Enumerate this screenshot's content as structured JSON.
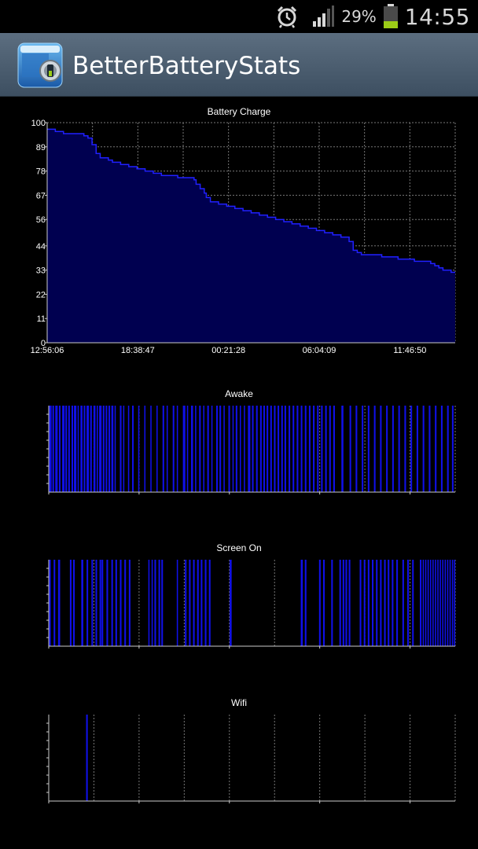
{
  "status_bar": {
    "battery_percent": "29%",
    "time": "14:55",
    "icons": [
      "alarm-clock-icon",
      "signal-strength-icon",
      "battery-icon"
    ]
  },
  "app": {
    "title": "BetterBatteryStats",
    "icon": "better-battery-stats-app-icon"
  },
  "colors": {
    "series_fill": "#000050",
    "series_line": "#2020ff",
    "bar_color": "#1010e8",
    "grid": "#777777",
    "background": "#000000",
    "action_bar": "#4a5c6e"
  },
  "chart_data": [
    {
      "type": "area",
      "title": "Battery Charge",
      "x_ticks": [
        "12:56:06",
        "18:38:47",
        "00:21:28",
        "06:04:09",
        "11:46:50"
      ],
      "y_ticks": [
        "0",
        "11",
        "22",
        "33",
        "44",
        "56",
        "67",
        "78",
        "89",
        "100"
      ],
      "ylim": [
        0,
        100
      ],
      "xlim": [
        0,
        100
      ],
      "grid": true,
      "x": [
        0,
        0.5,
        2,
        3,
        4,
        6,
        8,
        9,
        10,
        11,
        12,
        13,
        15,
        16,
        18,
        20,
        22,
        24,
        26,
        28,
        30,
        32,
        34,
        36,
        36.5,
        37.5,
        38.5,
        39,
        40,
        42,
        44,
        46,
        48,
        50,
        52,
        54,
        56,
        58,
        60,
        62,
        64,
        66,
        68,
        70,
        72,
        74,
        75,
        76,
        77,
        78,
        79,
        80,
        82,
        84,
        86,
        88,
        90,
        92,
        94,
        95,
        96,
        97,
        98,
        99,
        100
      ],
      "values": [
        97,
        97,
        96,
        96,
        95,
        95,
        95,
        94,
        93,
        90,
        86,
        84,
        83,
        82,
        81,
        80,
        79,
        78,
        77,
        76,
        76,
        75,
        75,
        74,
        72,
        70,
        68,
        66,
        64,
        63,
        62,
        61,
        60,
        59,
        58,
        57,
        56,
        55,
        54,
        53,
        52,
        51,
        50,
        49,
        48,
        46,
        42,
        41,
        40,
        40,
        40,
        40,
        39,
        39,
        38,
        38,
        37,
        37,
        36,
        35,
        34,
        33,
        33,
        32,
        32
      ]
    },
    {
      "type": "bar",
      "title": "Awake",
      "ylim": [
        0,
        1
      ],
      "grid": true,
      "segments": [
        [
          0,
          0.7
        ],
        [
          0.9,
          1.3
        ],
        [
          1.6,
          2.2
        ],
        [
          2.5,
          2.9
        ],
        [
          3.3,
          3.9
        ],
        [
          4.1,
          4.5
        ],
        [
          4.8,
          5.2
        ],
        [
          5.6,
          6.0
        ],
        [
          6.2,
          6.8
        ],
        [
          7.1,
          7.4
        ],
        [
          7.8,
          8.3
        ],
        [
          8.6,
          9.0
        ],
        [
          9.3,
          9.9
        ],
        [
          10.2,
          10.6
        ],
        [
          11.0,
          11.5
        ],
        [
          11.8,
          12.1
        ],
        [
          12.4,
          13.0
        ],
        [
          13.3,
          13.7
        ],
        [
          14.0,
          14.4
        ],
        [
          14.7,
          15.1
        ],
        [
          15.4,
          15.9
        ],
        [
          16.2,
          16.4
        ],
        [
          17.5,
          17.9
        ],
        [
          18.3,
          18.6
        ],
        [
          19.5,
          19.8
        ],
        [
          20.5,
          20.9
        ],
        [
          22.0,
          22.3
        ],
        [
          23.5,
          23.8
        ],
        [
          25.0,
          25.3
        ],
        [
          26.5,
          26.8
        ],
        [
          28.0,
          28.4
        ],
        [
          29.0,
          29.3
        ],
        [
          30.5,
          30.9
        ],
        [
          31.5,
          31.8
        ],
        [
          33.0,
          33.6
        ],
        [
          34.0,
          34.3
        ],
        [
          35.0,
          35.5
        ],
        [
          36.0,
          36.3
        ],
        [
          37.0,
          37.4
        ],
        [
          38.0,
          38.3
        ],
        [
          39.0,
          39.4
        ],
        [
          40.0,
          40.3
        ],
        [
          41.2,
          41.6
        ],
        [
          42.0,
          42.4
        ],
        [
          43.0,
          43.3
        ],
        [
          44.2,
          44.6
        ],
        [
          45.2,
          45.5
        ],
        [
          46.0,
          46.4
        ],
        [
          47.0,
          47.3
        ],
        [
          48.0,
          48.3
        ],
        [
          49.0,
          49.6
        ],
        [
          50.0,
          50.4
        ],
        [
          51.0,
          51.4
        ],
        [
          52.0,
          52.4
        ],
        [
          52.8,
          53.2
        ],
        [
          53.6,
          54.0
        ],
        [
          54.5,
          54.9
        ],
        [
          55.4,
          55.8
        ],
        [
          56.3,
          56.7
        ],
        [
          57.2,
          57.6
        ],
        [
          58.0,
          58.4
        ],
        [
          59.0,
          59.4
        ],
        [
          60.0,
          60.4
        ],
        [
          61.0,
          61.4
        ],
        [
          62.0,
          62.4
        ],
        [
          63.0,
          63.4
        ],
        [
          64.0,
          64.4
        ],
        [
          65.0,
          65.4
        ],
        [
          66.0,
          66.4
        ],
        [
          67.0,
          67.4
        ],
        [
          68.0,
          68.4
        ],
        [
          69.0,
          69.4
        ],
        [
          70.0,
          70.4
        ],
        [
          72.0,
          72.5
        ],
        [
          74.0,
          74.4
        ],
        [
          75.5,
          75.9
        ],
        [
          77.0,
          77.4
        ],
        [
          78.5,
          78.9
        ],
        [
          80.0,
          80.4
        ],
        [
          81.5,
          81.9
        ],
        [
          83.0,
          83.4
        ],
        [
          84.5,
          84.9
        ],
        [
          86.0,
          86.4
        ],
        [
          87.5,
          87.9
        ],
        [
          89.0,
          89.4
        ],
        [
          90.5,
          90.9
        ],
        [
          92.0,
          92.4
        ],
        [
          93.5,
          93.9
        ],
        [
          95.0,
          95.4
        ],
        [
          96.5,
          96.9
        ],
        [
          98.0,
          98.4
        ],
        [
          99.2,
          99.6
        ]
      ]
    },
    {
      "type": "bar",
      "title": "Screen On",
      "ylim": [
        0,
        1
      ],
      "grid": true,
      "segments": [
        [
          0,
          0.5
        ],
        [
          1.2,
          1.6
        ],
        [
          2.3,
          2.8
        ],
        [
          5.2,
          5.6
        ],
        [
          6.0,
          6.4
        ],
        [
          8.0,
          8.5
        ],
        [
          9.3,
          9.7
        ],
        [
          10.5,
          10.9
        ],
        [
          11.5,
          11.9
        ],
        [
          12.5,
          12.9
        ],
        [
          13.0,
          13.4
        ],
        [
          14.2,
          14.6
        ],
        [
          15.4,
          15.8
        ],
        [
          16.4,
          16.8
        ],
        [
          17.5,
          17.9
        ],
        [
          18.6,
          19.0
        ],
        [
          19.7,
          20.1
        ],
        [
          24.5,
          24.8
        ],
        [
          25.3,
          25.6
        ],
        [
          26.0,
          26.4
        ],
        [
          27.0,
          27.4
        ],
        [
          27.7,
          28.1
        ],
        [
          31.5,
          31.8
        ],
        [
          33.5,
          33.9
        ],
        [
          34.5,
          34.9
        ],
        [
          35.5,
          35.9
        ],
        [
          36.5,
          36.9
        ],
        [
          37.4,
          37.8
        ],
        [
          38.4,
          38.8
        ],
        [
          39.4,
          39.8
        ],
        [
          44.5,
          45.0
        ],
        [
          62.0,
          62.5
        ],
        [
          63.0,
          63.4
        ],
        [
          66.5,
          66.9
        ],
        [
          67.5,
          67.9
        ],
        [
          69.5,
          69.9
        ],
        [
          71.5,
          71.9
        ],
        [
          72.3,
          72.7
        ],
        [
          73.0,
          73.4
        ],
        [
          73.8,
          74.2
        ],
        [
          76.5,
          76.9
        ],
        [
          77.5,
          77.9
        ],
        [
          78.5,
          78.9
        ],
        [
          79.5,
          79.9
        ],
        [
          80.5,
          80.9
        ],
        [
          81.5,
          81.9
        ],
        [
          82.5,
          82.9
        ],
        [
          83.4,
          83.8
        ],
        [
          84.4,
          84.8
        ],
        [
          85.5,
          85.9
        ],
        [
          87.0,
          87.4
        ],
        [
          88.2,
          88.6
        ],
        [
          89.4,
          89.8
        ],
        [
          91.3,
          91.7
        ],
        [
          92.0,
          92.3
        ],
        [
          92.6,
          92.9
        ],
        [
          93.2,
          93.5
        ],
        [
          93.8,
          94.1
        ],
        [
          94.4,
          94.7
        ],
        [
          95.0,
          95.3
        ],
        [
          95.6,
          95.9
        ],
        [
          96.2,
          96.5
        ],
        [
          96.8,
          97.1
        ],
        [
          97.4,
          97.7
        ],
        [
          98.0,
          98.3
        ],
        [
          98.6,
          98.9
        ],
        [
          99.2,
          99.5
        ],
        [
          99.7,
          100
        ]
      ]
    },
    {
      "type": "bar",
      "title": "Wifi",
      "ylim": [
        0,
        1
      ],
      "grid": true,
      "segments": [
        [
          9.2,
          9.6
        ]
      ]
    }
  ]
}
